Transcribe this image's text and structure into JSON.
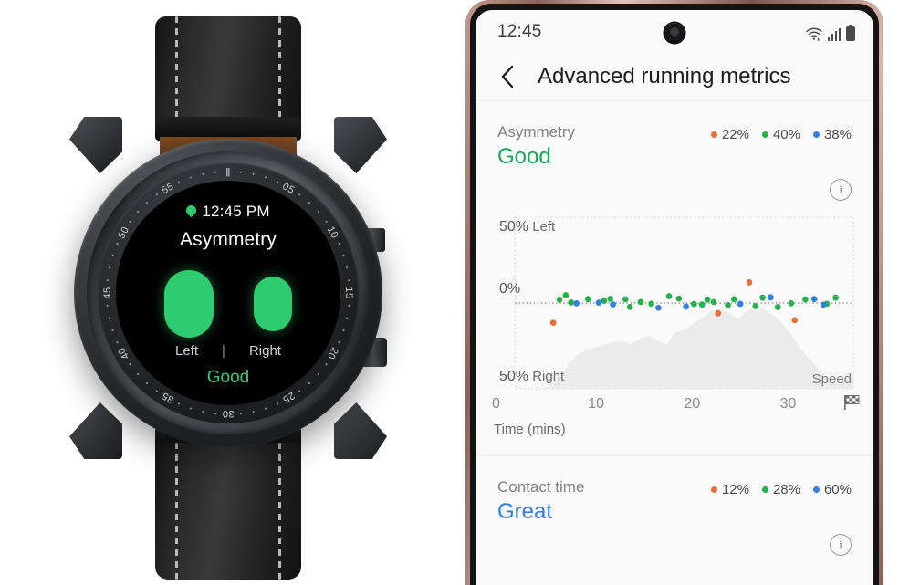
{
  "watch": {
    "time": "12:45 PM",
    "location_icon": "location-pin-icon",
    "title": "Asymmetry",
    "left_label": "Left",
    "separator": "|",
    "right_label": "Right",
    "status": "Good",
    "status_color": "#2ecc71",
    "bar_color": "#2ecc71",
    "bezel_numbers": [
      "05",
      "10",
      "15",
      "20",
      "25",
      "30",
      "35",
      "40",
      "45",
      "50",
      "55"
    ]
  },
  "phone": {
    "statusbar": {
      "time": "12:45",
      "wifi_icon": "wifi-icon",
      "signal_icon": "cellular-signal-icon",
      "battery_icon": "battery-icon"
    },
    "appbar": {
      "back_icon": "chevron-left-icon",
      "title": "Advanced running metrics"
    },
    "sections": [
      {
        "name": "Asymmetry",
        "value": "Good",
        "value_color": "#1aa85a",
        "legend": [
          {
            "color": "#ec6b35",
            "label": "22%"
          },
          {
            "color": "#24b24b",
            "label": "40%"
          },
          {
            "color": "#2f7fe4",
            "label": "38%"
          }
        ],
        "info_label": "i"
      },
      {
        "name": "Contact time",
        "value": "Great",
        "value_color": "#2f7fe4",
        "legend": [
          {
            "color": "#ec6b35",
            "label": "12%"
          },
          {
            "color": "#24b24b",
            "label": "28%"
          },
          {
            "color": "#2f7fe4",
            "label": "60%"
          }
        ],
        "info_label": "i"
      }
    ]
  },
  "chart_data": {
    "type": "scatter",
    "title": "Asymmetry",
    "xlabel": "Time (mins)",
    "ylabel": "",
    "xlim": [
      0,
      38
    ],
    "ylim": [
      -50,
      50
    ],
    "xticks": [
      0,
      10,
      20,
      30
    ],
    "xticklabels": [
      "0",
      "10",
      "20",
      "30"
    ],
    "y_axis_annotations": [
      {
        "value": 50,
        "label_bold": "50%",
        "label_rest": "Left"
      },
      {
        "value": 0,
        "label_bold": "0%",
        "label_rest": ""
      },
      {
        "value": -50,
        "label_bold": "50%",
        "label_rest": "Right"
      }
    ],
    "zero_line": true,
    "grid": "dotted-border",
    "end_marker_icon": "checkered-flag-icon",
    "series": [
      {
        "name": "22%",
        "color": "#ec6b35",
        "points": [
          {
            "x": 4.3,
            "y": -11.5
          },
          {
            "x": 22.8,
            "y": -6.0
          },
          {
            "x": 26.3,
            "y": 12.0
          },
          {
            "x": 31.4,
            "y": -10.0
          }
        ]
      },
      {
        "name": "40%",
        "color": "#24b24b",
        "points": [
          {
            "x": 5.0,
            "y": 2.0
          },
          {
            "x": 5.7,
            "y": 4.5
          },
          {
            "x": 6.3,
            "y": 0.3
          },
          {
            "x": 8.2,
            "y": 2.3
          },
          {
            "x": 10.0,
            "y": 1.3
          },
          {
            "x": 10.7,
            "y": 2.4
          },
          {
            "x": 12.4,
            "y": 2.2
          },
          {
            "x": 12.9,
            "y": -2.3
          },
          {
            "x": 14.1,
            "y": 0.6
          },
          {
            "x": 15.3,
            "y": -0.4
          },
          {
            "x": 17.3,
            "y": 4.0
          },
          {
            "x": 18.4,
            "y": 2.6
          },
          {
            "x": 20.1,
            "y": -0.6
          },
          {
            "x": 21.0,
            "y": -0.9
          },
          {
            "x": 21.6,
            "y": 2.0
          },
          {
            "x": 22.3,
            "y": 0.6
          },
          {
            "x": 23.9,
            "y": -1.2
          },
          {
            "x": 24.6,
            "y": 2.2
          },
          {
            "x": 27.0,
            "y": -1.8
          },
          {
            "x": 27.8,
            "y": 3.1
          },
          {
            "x": 29.5,
            "y": -2.4
          },
          {
            "x": 31.0,
            "y": -0.2
          },
          {
            "x": 32.6,
            "y": 2.1
          },
          {
            "x": 35.0,
            "y": -0.5
          },
          {
            "x": 36.0,
            "y": 3.1
          }
        ]
      },
      {
        "name": "38%",
        "color": "#2f7fe4",
        "points": [
          {
            "x": 6.9,
            "y": -0.2
          },
          {
            "x": 9.4,
            "y": 0.2
          },
          {
            "x": 11.0,
            "y": -0.8
          },
          {
            "x": 16.1,
            "y": -2.8
          },
          {
            "x": 19.2,
            "y": -2.1
          },
          {
            "x": 25.3,
            "y": -0.5
          },
          {
            "x": 28.7,
            "y": 3.3
          },
          {
            "x": 33.6,
            "y": 2.3
          },
          {
            "x": 34.6,
            "y": -1.0
          }
        ]
      }
    ],
    "area_series": {
      "name": "Speed",
      "color": "#ebebeb",
      "label": "Speed",
      "x": [
        0,
        1,
        2,
        3,
        4,
        5,
        6,
        7,
        8,
        9,
        10,
        11,
        12,
        13,
        14,
        15,
        16,
        17,
        18,
        19,
        20,
        21,
        22,
        23,
        24,
        25,
        26,
        27,
        28,
        29,
        30,
        31,
        32,
        33,
        34,
        35,
        36,
        37,
        38
      ],
      "y": [
        -50,
        -50,
        -50,
        -50,
        -48,
        -44,
        -36,
        -30,
        -27,
        -26,
        -24,
        -23,
        -22,
        -24,
        -21,
        -19,
        -22,
        -24,
        -17,
        -16,
        -12,
        -9,
        -5,
        -3,
        -6,
        -9,
        -5,
        -2,
        -4,
        -7,
        -12,
        -18,
        -26,
        -32,
        -38,
        -44,
        -47,
        -45,
        -42
      ]
    }
  }
}
